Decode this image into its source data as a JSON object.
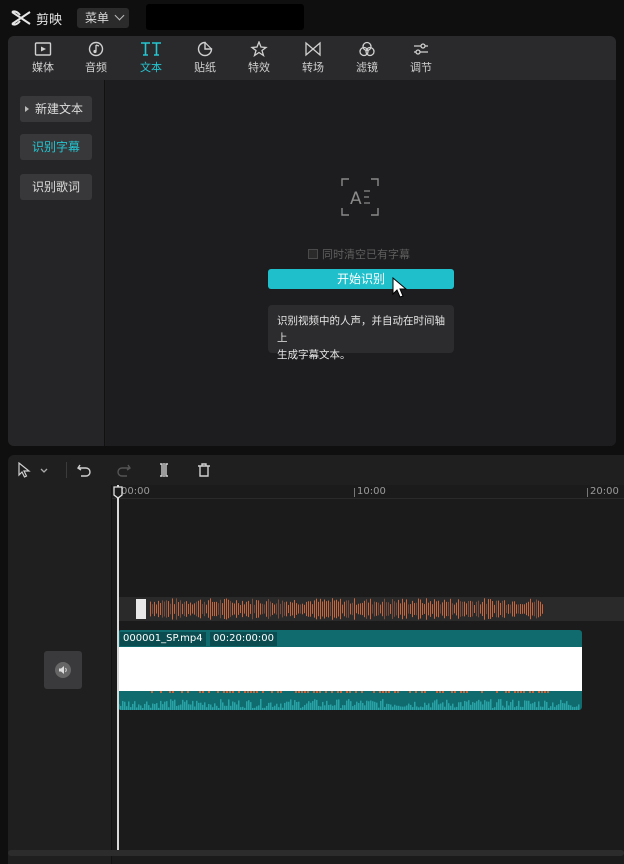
{
  "app": {
    "name": "剪映",
    "menu_label": "菜单"
  },
  "toolbar": {
    "items": [
      {
        "label": "媒体",
        "icon": "media-icon"
      },
      {
        "label": "音频",
        "icon": "audio-icon"
      },
      {
        "label": "文本",
        "icon": "text-icon",
        "active": true
      },
      {
        "label": "贴纸",
        "icon": "sticker-icon"
      },
      {
        "label": "特效",
        "icon": "effects-icon"
      },
      {
        "label": "转场",
        "icon": "transition-icon"
      },
      {
        "label": "滤镜",
        "icon": "filter-icon"
      },
      {
        "label": "调节",
        "icon": "adjust-icon"
      }
    ]
  },
  "sidebar": {
    "items": [
      {
        "label": "新建文本"
      },
      {
        "label": "识别字幕",
        "active": true
      },
      {
        "label": "识别歌词"
      }
    ]
  },
  "content": {
    "icon_text": "A",
    "clear_label": "同时清空已有字幕",
    "start_label": "开始识别",
    "tip_line1": "识别视频中的人声，并自动在时间轴上",
    "tip_line2": "生成字幕文本。"
  },
  "timeline": {
    "ticks": [
      "00:00",
      "10:00",
      "20:00"
    ],
    "clip_name": "000001_SP.mp4",
    "clip_duration": "00:20:00:00"
  },
  "colors": {
    "accent": "#1fc0cc",
    "clip": "#0f6b6e",
    "waveform": "#c8653d"
  }
}
